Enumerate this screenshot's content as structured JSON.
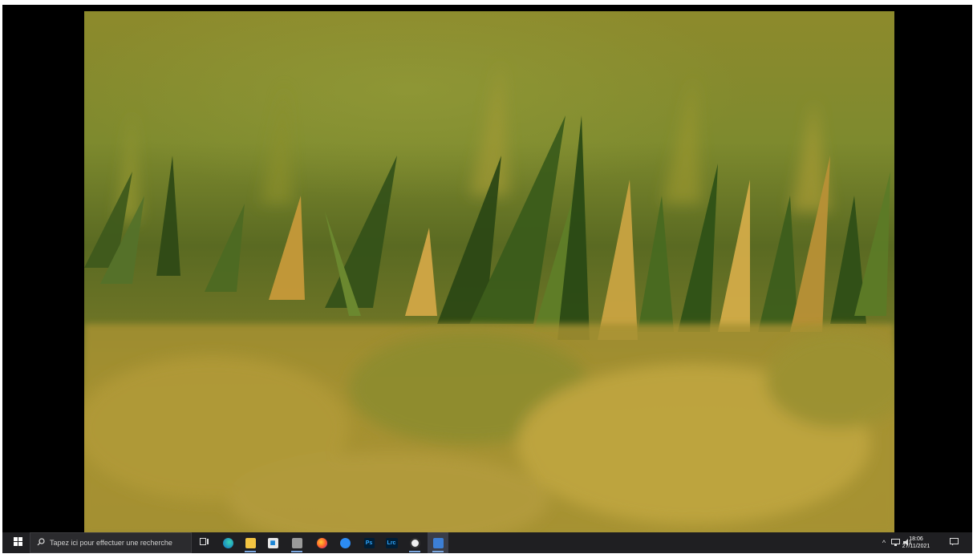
{
  "taskbar": {
    "search_placeholder": "Tapez ici pour effectuer une recherche",
    "apps": [
      {
        "name": "task-view",
        "icon": "task-view-icon"
      },
      {
        "name": "edge",
        "icon": "edge-icon"
      },
      {
        "name": "file-explorer",
        "icon": "folder-icon"
      },
      {
        "name": "store",
        "icon": "store-icon"
      },
      {
        "name": "camera",
        "icon": "camera-icon"
      },
      {
        "name": "firefox",
        "icon": "firefox-icon"
      },
      {
        "name": "messenger",
        "icon": "chat-icon"
      },
      {
        "name": "photoshop",
        "label": "Ps"
      },
      {
        "name": "lightroom-classic",
        "label": "Lrc"
      },
      {
        "name": "app-circle",
        "icon": "circle-app-icon"
      },
      {
        "name": "photos",
        "icon": "photos-icon"
      }
    ],
    "time": "18:06",
    "date": "27/11/2021"
  },
  "colors": {
    "taskbar_bg": "#1f1f22",
    "accent": "#7aa7e0",
    "photoshop": "#31a8ff",
    "lightroom": "#31a8ff"
  }
}
